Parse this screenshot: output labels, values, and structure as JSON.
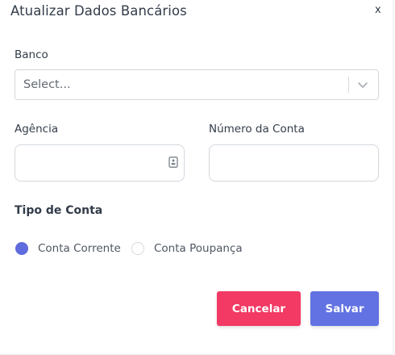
{
  "modal": {
    "title": "Atualizar Dados Bancários",
    "close_label": "x"
  },
  "form": {
    "bank": {
      "label": "Banco",
      "placeholder": "Select..."
    },
    "agency": {
      "label": "Agência",
      "value": ""
    },
    "account_number": {
      "label": "Número da Conta",
      "value": ""
    },
    "account_type": {
      "label": "Tipo de Conta",
      "options": [
        {
          "label": "Conta Corrente",
          "checked": true
        },
        {
          "label": "Conta Poupança",
          "checked": false
        }
      ]
    }
  },
  "actions": {
    "cancel_label": "Cancelar",
    "save_label": "Salvar"
  },
  "colors": {
    "cancel_button": "#f23a64",
    "save_button": "#6272e2",
    "radio_checked": "#5f6cde"
  },
  "icons": {
    "select_indicator": "chevron-down-icon",
    "agency_field_adornment": "contact-card-icon"
  }
}
